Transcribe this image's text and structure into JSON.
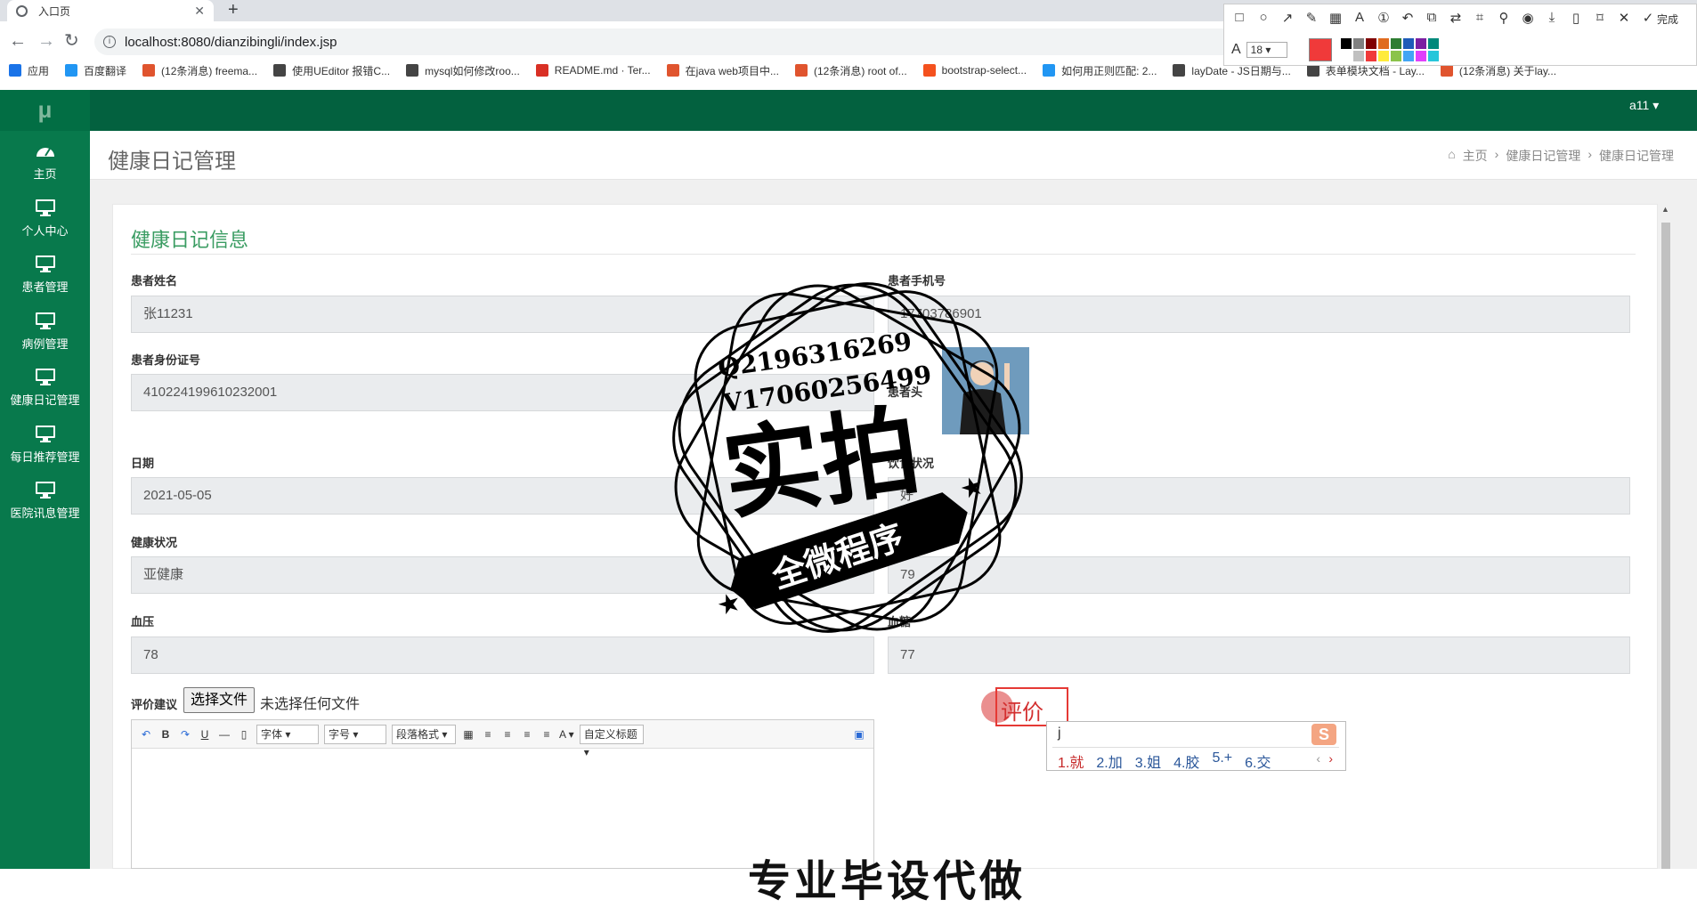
{
  "browser": {
    "tab_title": "入口页",
    "url": "localhost:8080/dianzibingli/index.jsp",
    "bookmarks": [
      {
        "label": "应用",
        "icon": "apps-grid-icon",
        "style": "grid"
      },
      {
        "label": "百度翻译",
        "icon": "translate-icon",
        "style": "blue"
      },
      {
        "label": "(12条消息) freema...",
        "icon": "csdn-icon",
        "style": ""
      },
      {
        "label": "使用UEditor 报错C...",
        "icon": "bookmark-icon",
        "style": "dark"
      },
      {
        "label": "mysql如何修改roo...",
        "icon": "bookmark-icon",
        "style": "dark"
      },
      {
        "label": "README.md · Ter...",
        "icon": "gitee-icon",
        "style": "red"
      },
      {
        "label": "在java web项目中...",
        "icon": "csdn-icon",
        "style": ""
      },
      {
        "label": "(12条消息) root of...",
        "icon": "csdn-icon",
        "style": ""
      },
      {
        "label": "bootstrap-select...",
        "icon": "bookmark-icon",
        "style": "orange"
      },
      {
        "label": "如何用正则匹配: 2...",
        "icon": "baidu-icon",
        "style": "blue"
      },
      {
        "label": "layDate - JS日期与...",
        "icon": "bookmark-icon",
        "style": "dark"
      },
      {
        "label": "表单模块文档 - Lay...",
        "icon": "bookmark-icon",
        "style": "dark"
      },
      {
        "label": "(12条消息) 关于lay...",
        "icon": "csdn-icon",
        "style": ""
      }
    ]
  },
  "screenshot_tool": {
    "done_label": "完成",
    "font_size": "18",
    "current_color": "#f03a3a",
    "palette": [
      "#000000",
      "#808080",
      "#800000",
      "#e06c1f",
      "#2e7d32",
      "#1e5bb8",
      "#7b1fa2",
      "#00897b",
      "#ffffff",
      "#c0c0c0",
      "#f03a3a",
      "#ffeb3b",
      "#8bc34a",
      "#42a5f5",
      "#e040fb",
      "#26c6da"
    ]
  },
  "app": {
    "logo": "μ",
    "user": "a11 ▾",
    "colors": {
      "header": "#03613f",
      "sidebar": "#08794c",
      "accent": "#3a9c62"
    },
    "sidebar": [
      {
        "label": "主页",
        "icon": "dashboard-icon"
      },
      {
        "label": "个人中心",
        "icon": "monitor-icon"
      },
      {
        "label": "患者管理",
        "icon": "monitor-icon"
      },
      {
        "label": "病例管理",
        "icon": "monitor-icon"
      },
      {
        "label": "健康日记管理",
        "icon": "monitor-icon"
      },
      {
        "label": "每日推荐管理",
        "icon": "monitor-icon"
      },
      {
        "label": "医院讯息管理",
        "icon": "monitor-icon"
      }
    ],
    "page_title": "健康日记管理",
    "breadcrumb": [
      "主页",
      "健康日记管理",
      "健康日记管理"
    ]
  },
  "form": {
    "title": "健康日记信息",
    "fields": {
      "patient_name": {
        "label": "患者姓名",
        "value": "张11231"
      },
      "patient_phone": {
        "label": "患者手机号",
        "value": "17703786901"
      },
      "patient_id": {
        "label": "患者身份证号",
        "value": "410224199610232001"
      },
      "patient_photo": {
        "label": "患者头"
      },
      "date": {
        "label": "日期",
        "value": "2021-05-05"
      },
      "diet": {
        "label": "饮食状况",
        "value": "好"
      },
      "health": {
        "label": "健康状况",
        "value": "亚健康"
      },
      "heart": {
        "label": "",
        "value": "79"
      },
      "blood_pressure": {
        "label": "血压",
        "value": "78"
      },
      "blood_sugar": {
        "label": "血糖",
        "value": "77"
      }
    },
    "eval_label": "评价建议",
    "file_button": "选择文件",
    "file_none": "未选择任何文件",
    "editor": {
      "font": "字体",
      "size": "字号",
      "para": "段落格式",
      "custom": "自定义标题"
    }
  },
  "overlay": {
    "eval_text": "评价",
    "ime_input": "j",
    "ime_candidates": [
      "1.就",
      "2.加",
      "3.姐",
      "4.胶",
      "5.+",
      "6.交"
    ],
    "ime_logo": "S",
    "watermark_line1": "Q2196316269",
    "watermark_line2": "V17060256499",
    "watermark_big": "实拍",
    "watermark_banner": "全微程序",
    "bottom_watermark": "专业毕设代做"
  }
}
